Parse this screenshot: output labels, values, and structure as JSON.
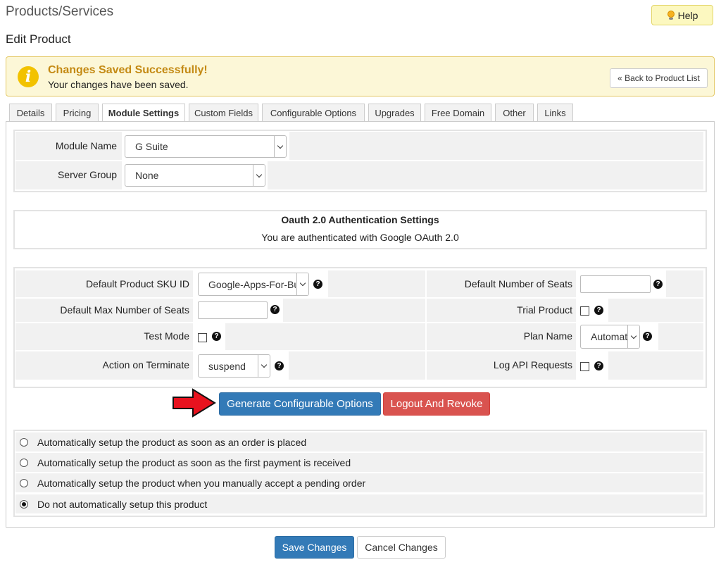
{
  "header": {
    "title": "Products/Services",
    "subtitle": "Edit Product",
    "help_label": "Help"
  },
  "alert": {
    "title": "Changes Saved Successfully!",
    "message": "Your changes have been saved.",
    "back_label": "« Back to Product List"
  },
  "tabs": [
    "Details",
    "Pricing",
    "Module Settings",
    "Custom Fields",
    "Configurable Options",
    "Upgrades",
    "Free Domain",
    "Other",
    "Links"
  ],
  "active_tab": "Module Settings",
  "module": {
    "module_name_label": "Module Name",
    "module_name_value": "G Suite",
    "server_group_label": "Server Group",
    "server_group_value": "None"
  },
  "oauth": {
    "title": "Oauth 2.0 Authentication Settings",
    "status": "You are authenticated with Google OAuth 2.0"
  },
  "settings": {
    "sku_label": "Default Product SKU ID",
    "sku_value": "Google-Apps-For-Business",
    "seats_label": "Default Number of Seats",
    "seats_value": "",
    "max_seats_label": "Default Max Number of Seats",
    "max_seats_value": "",
    "trial_label": "Trial Product",
    "trial_checked": false,
    "test_mode_label": "Test Mode",
    "test_mode_checked": false,
    "plan_label": "Plan Name",
    "plan_value": "Automatic",
    "terminate_label": "Action on Terminate",
    "terminate_value": "suspend",
    "log_label": "Log API Requests",
    "log_checked": false,
    "help_glyph": "?"
  },
  "actions": {
    "generate_label": "Generate Configurable Options",
    "logout_label": "Logout And Revoke"
  },
  "setup_options": [
    {
      "label": "Automatically setup the product as soon as an order is placed",
      "selected": false
    },
    {
      "label": "Automatically setup the product as soon as the first payment is received",
      "selected": false
    },
    {
      "label": "Automatically setup the product when you manually accept a pending order",
      "selected": false
    },
    {
      "label": "Do not automatically setup this product",
      "selected": true
    }
  ],
  "footer": {
    "save_label": "Save Changes",
    "cancel_label": "Cancel Changes"
  },
  "colors": {
    "primary": "#337ab7",
    "danger": "#d9534f",
    "alert_bg": "#fcf7d7",
    "alert_title": "#c48a14",
    "arrow": "#e8121e"
  }
}
